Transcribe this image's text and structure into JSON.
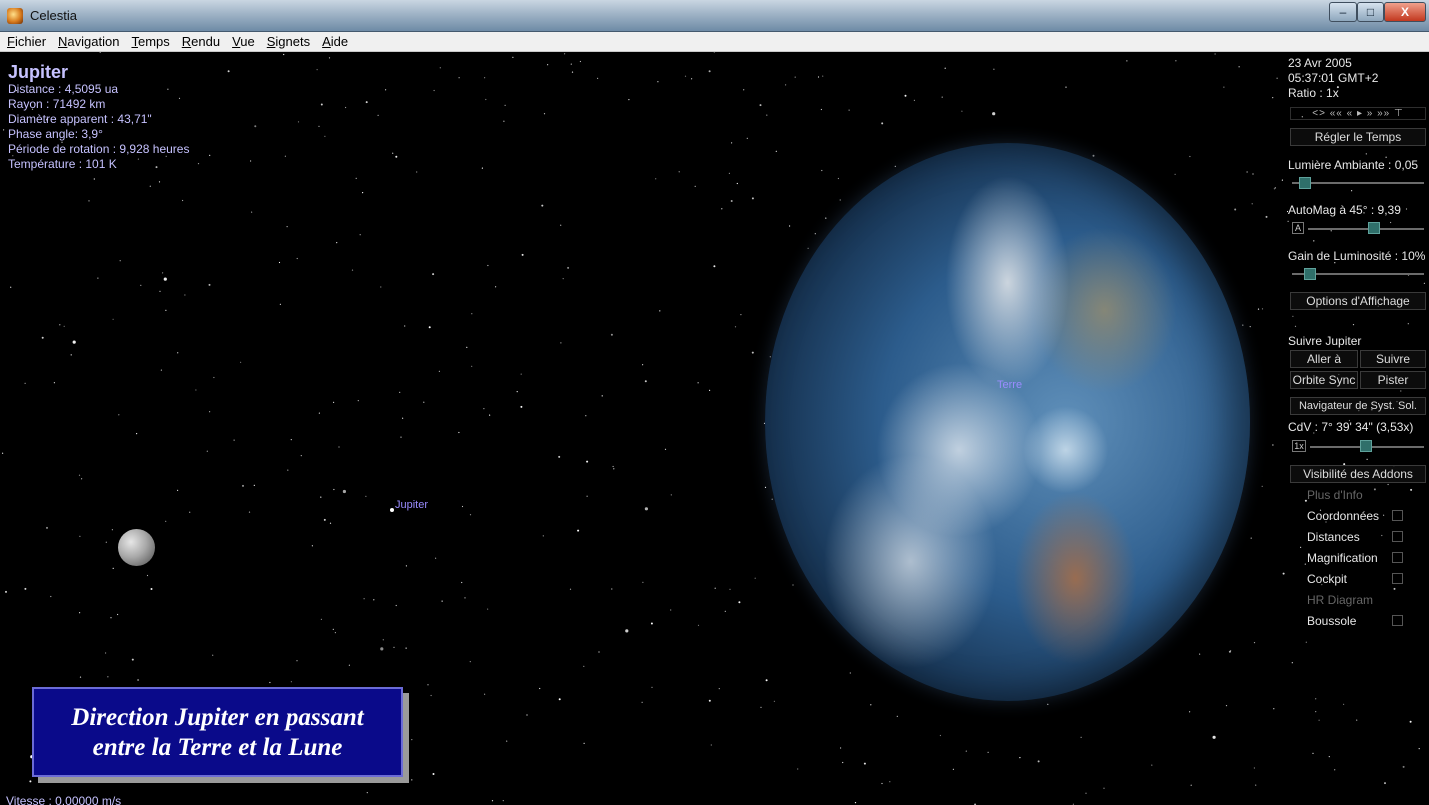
{
  "window": {
    "title": "Celestia",
    "minimize": "–",
    "maximize": "□",
    "close": "X"
  },
  "menu": [
    {
      "u": "F",
      "rest": "ichier"
    },
    {
      "u": "N",
      "rest": "avigation"
    },
    {
      "u": "T",
      "rest": "emps"
    },
    {
      "u": "R",
      "rest": "endu"
    },
    {
      "u": "V",
      "rest": "ue"
    },
    {
      "u": "S",
      "rest": "ignets"
    },
    {
      "u": "A",
      "rest": "ide"
    }
  ],
  "info": {
    "name": "Jupiter",
    "distance": "Distance : 4,5095 ua",
    "radius": "Rayon : 71492 km",
    "apparent_diameter": "Diamètre apparent : 43,71\"",
    "phase_angle": "Phase angle: 3,9°",
    "rotation_period": "Période de rotation : 9,928 heures",
    "temperature": "Température : 101 K"
  },
  "labels": {
    "earth": "Terre",
    "jupiter": "Jupiter"
  },
  "panel": {
    "date": "23 Avr 2005",
    "time": "05:37:01 GMT+2",
    "ratio": "Ratio : 1x",
    "time_controls": "<> «« « ▸ » »» ⊤",
    "set_time": "Régler le Temps",
    "ambient_light": "Lumière Ambiante : 0,05",
    "ambient_light_value": 0.05,
    "automag": "AutoMag à 45° : 9,39",
    "automag_button": "A",
    "brightness_gain": "Gain de Luminosité : 10%",
    "display_options": "Options d'Affichage",
    "follow_title": "Suivre Jupiter",
    "goto": "Aller à",
    "follow": "Suivre",
    "orbit_sync": "Orbite Sync",
    "track": "Pister",
    "solar_browser": "Navigateur de Syst. Sol.",
    "fov": "CdV : 7° 39' 34\" (3,53x)",
    "fov_button": "1x",
    "addons_visibility": "Visibilité des Addons",
    "more_info": "Plus d'Info",
    "coordinates": "Coordonnées",
    "distances": "Distances",
    "magnification": "Magnification",
    "cockpit": "Cockpit",
    "hr_diagram": "HR Diagram",
    "compass": "Boussole"
  },
  "caption": {
    "line1": "Direction Jupiter en passant",
    "line2": "entre la Terre et la Lune"
  },
  "speed": "Vitesse : 0,00000 m/s"
}
